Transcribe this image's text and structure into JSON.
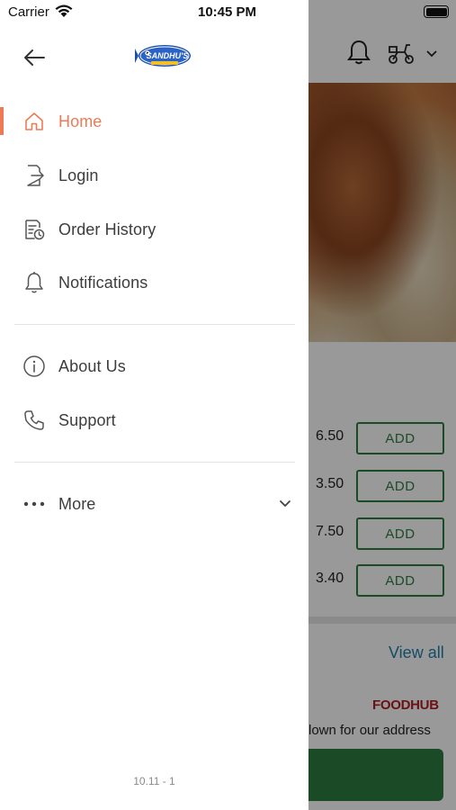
{
  "status_bar": {
    "carrier": "Carrier",
    "time": "10:45 PM"
  },
  "drawer": {
    "logo_text": "SANDHU'S",
    "menu_primary": [
      {
        "label": "Home",
        "icon": "home-icon",
        "active": true
      },
      {
        "label": "Login",
        "icon": "login-icon",
        "active": false
      },
      {
        "label": "Order History",
        "icon": "order-history-icon",
        "active": false
      },
      {
        "label": "Notifications",
        "icon": "bell-icon",
        "active": false
      }
    ],
    "menu_secondary": [
      {
        "label": "About Us",
        "icon": "info-icon"
      },
      {
        "label": "Support",
        "icon": "phone-icon"
      }
    ],
    "more_label": "More",
    "version": "10.11 - 1"
  },
  "background": {
    "prices": [
      "6.50",
      "3.50",
      "7.50",
      "3.40"
    ],
    "add_label": "ADD",
    "view_all": "View all",
    "brand": "FOODHUB",
    "address_text": "lown for our address"
  },
  "colors": {
    "accent": "#ee7a55",
    "green": "#2e7d40",
    "link": "#1e7fa8",
    "brand_red": "#b01e24"
  }
}
